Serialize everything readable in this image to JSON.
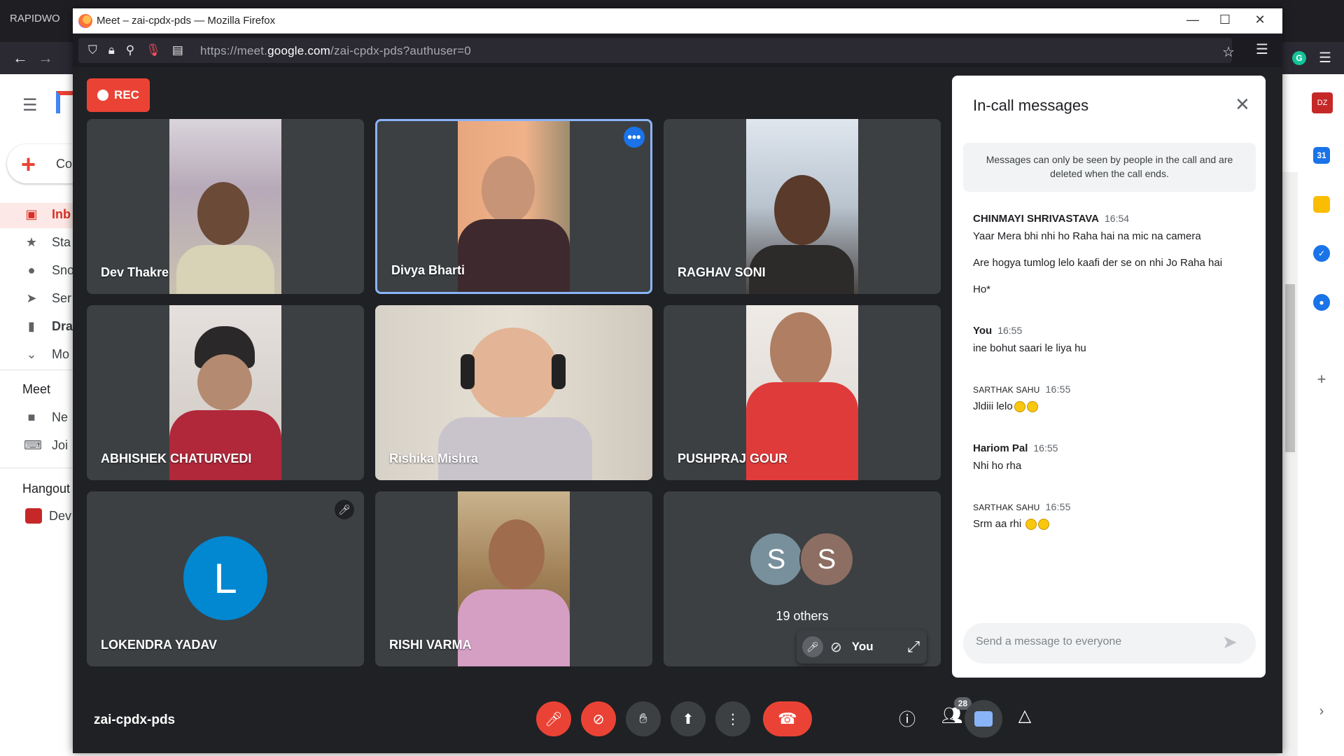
{
  "browser_bg": {
    "tab_title": "RAPIDWO",
    "grammarly_label": "G"
  },
  "gmail": {
    "compose_label": "Co",
    "nav": [
      {
        "icon": "inbox-icon",
        "label": "Inb"
      },
      {
        "icon": "star-icon",
        "label": "Sta"
      },
      {
        "icon": "clock-icon",
        "label": "Sno"
      },
      {
        "icon": "send-icon",
        "label": "Ser"
      },
      {
        "icon": "file-icon",
        "label": "Dra"
      },
      {
        "icon": "chevron-down-icon",
        "label": "Mo"
      }
    ],
    "meet_heading": "Meet",
    "meet_items": [
      {
        "icon": "video-icon",
        "label": "Ne"
      },
      {
        "icon": "keyboard-icon",
        "label": "Joi"
      }
    ],
    "hangouts_heading": "Hangout",
    "hangouts_user": "Dev",
    "calendar_date": "31"
  },
  "firefox": {
    "window_title": "Meet – zai-cpdx-pds — Mozilla Firefox",
    "url_prefix": "https://meet.",
    "url_domain": "google.com",
    "url_suffix": "/zai-cpdx-pds?authuser=0"
  },
  "meet": {
    "rec_label": "REC",
    "meeting_code": "zai-cpdx-pds",
    "participants": [
      {
        "name": "Dev Thakre"
      },
      {
        "name": "Divya Bharti"
      },
      {
        "name": "RAGHAV SONI"
      },
      {
        "name": "ABHISHEK CHATURVEDI"
      },
      {
        "name": "Rishika Mishra"
      },
      {
        "name": "PUSHPRAJ GOUR"
      },
      {
        "name": "LOKENDRA YADAV",
        "avatar_letter": "L"
      },
      {
        "name": "RISHI VARMA"
      }
    ],
    "others": {
      "avatar1": "S",
      "avatar2": "S",
      "label": "19 others"
    },
    "self_label": "You",
    "people_count": "28",
    "colors": {
      "accent": "#1a73e8",
      "danger": "#ea4335",
      "tile": "#3c4043",
      "bg": "#202124"
    }
  },
  "chat": {
    "title": "In-call messages",
    "notice": "Messages can only be seen by people in the call and are deleted when the call ends.",
    "messages": [
      {
        "sender": "CHINMAYI SHRIVASTAVA",
        "time": "16:54",
        "lines": [
          "Yaar Mera bhi nhi ho Raha hai na mic na camera",
          "Are hogya tumlog lelo kaafi der se on nhi Jo Raha hai",
          "Ho*"
        ]
      },
      {
        "sender": "You",
        "time": "16:55",
        "lines": [
          "ine bohut saari le liya hu"
        ]
      },
      {
        "sender": "SARTHAK SAHU",
        "time": "16:55",
        "lines": [
          "Jldiii lelo"
        ]
      },
      {
        "sender": "Hariom Pal",
        "time": "16:55",
        "lines": [
          "Nhi ho rha"
        ]
      },
      {
        "sender": "SARTHAK SAHU",
        "time": "16:55",
        "lines": [
          "Srm aa rhi"
        ]
      }
    ],
    "input_placeholder": "Send a message to everyone"
  }
}
